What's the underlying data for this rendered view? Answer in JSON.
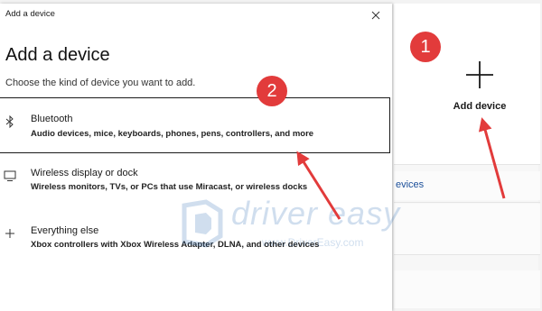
{
  "background_page": {
    "add_device_label": "Add device",
    "devices_link_partial": "evices",
    "plus_icon": "plus-icon"
  },
  "dialog": {
    "titlebar": "Add a device",
    "heading": "Add a device",
    "subtitle": "Choose the kind of device you want to add.",
    "close_icon": "close-icon",
    "options": [
      {
        "icon": "bluetooth-icon",
        "title": "Bluetooth",
        "description": "Audio devices, mice, keyboards, phones, pens, controllers, and more"
      },
      {
        "icon": "monitor-icon",
        "title": "Wireless display or dock",
        "description": "Wireless monitors, TVs, or PCs that use Miracast, or wireless docks"
      },
      {
        "icon": "plus-icon",
        "title": "Everything else",
        "description": "Xbox controllers with Xbox Wireless Adapter, DLNA, and other devices"
      }
    ]
  },
  "annotations": {
    "badge_1": "1",
    "badge_2": "2",
    "accent_color": "#e23b3b"
  },
  "watermark": {
    "brand": "driver easy",
    "url": "www.DriverEasy.com"
  }
}
